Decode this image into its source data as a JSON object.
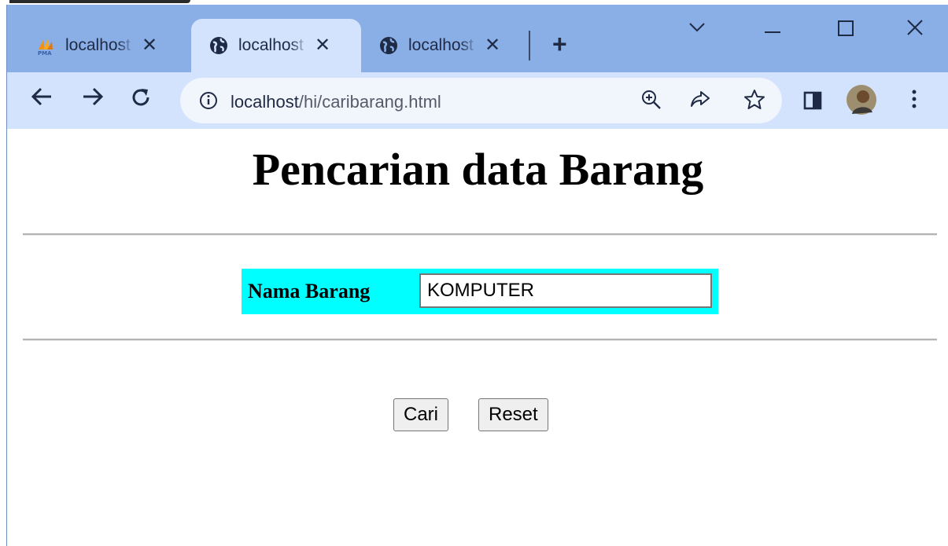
{
  "browser": {
    "tabs": [
      {
        "title": "localhost",
        "icon": "phpmyadmin-icon",
        "active": false
      },
      {
        "title": "localhost",
        "icon": "globe-icon",
        "active": true
      },
      {
        "title": "localhost",
        "icon": "globe-icon",
        "active": false
      }
    ],
    "new_tab_label": "+",
    "url_host": "localhost",
    "url_path": "/hi/caribarang.html"
  },
  "page": {
    "heading": "Pencarian data Barang",
    "field_label": "Nama Barang",
    "field_value": "KOMPUTER",
    "field_bg_color": "#00ffff",
    "search_button": "Cari",
    "reset_button": "Reset"
  }
}
